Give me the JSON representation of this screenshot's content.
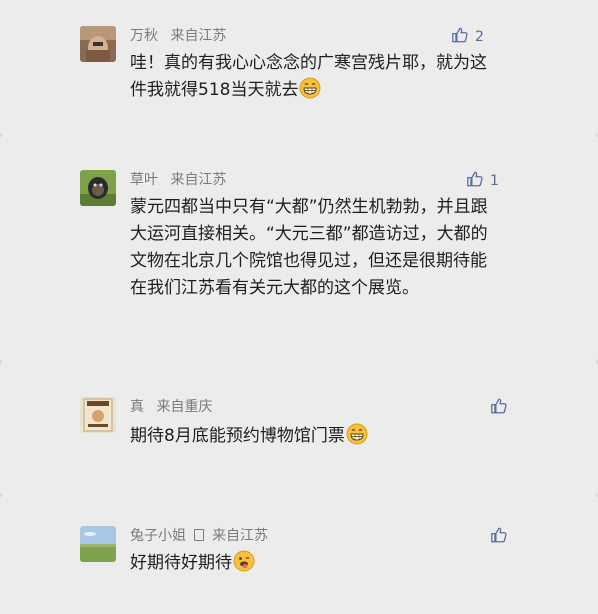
{
  "comments": [
    {
      "author": "万秋",
      "location": "来自江苏",
      "likes": "2",
      "text": "哇！真的有我心心念念的广寒宫残片耶，就为这件我就得518当天就去",
      "emoji": "grinning-face-icon"
    },
    {
      "author": "草叶",
      "location": "来自江苏",
      "likes": "1",
      "text": "蒙元四都当中只有“大都”仍然生机勃勃，并且跟大运河直接相关。“大元三都”都造访过，大都的文物在北京几个院馆也得见过，但还是很期待能在我们江苏看有关元大都的这个展览。",
      "emoji": ""
    },
    {
      "author": "真",
      "location": "来自重庆",
      "likes": "",
      "text": "期待8月底能预约博物馆门票",
      "emoji": "grinning-face-icon"
    },
    {
      "author": "兔子小姐",
      "location": "来自江苏",
      "likes": "",
      "text": "好期待好期待",
      "emoji": "tongue-face-icon"
    }
  ]
}
